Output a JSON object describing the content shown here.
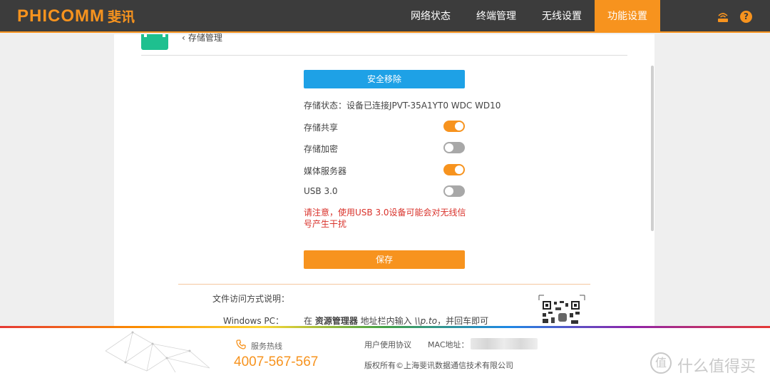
{
  "header": {
    "logo_text": "PHICOMM",
    "logo_cn": "斐讯",
    "nav": [
      {
        "label": "网络状态",
        "active": false
      },
      {
        "label": "终端管理",
        "active": false
      },
      {
        "label": "无线设置",
        "active": false
      },
      {
        "label": "功能设置",
        "active": true
      }
    ],
    "help_glyph": "?"
  },
  "page": {
    "back_label": "存储管理",
    "remove_button": "安全移除",
    "status_text": "存储状态：设备已连接JPVT-35A1YT0 WDC WD10",
    "settings": [
      {
        "label": "存储共享",
        "on": true
      },
      {
        "label": "存储加密",
        "on": false
      },
      {
        "label": "媒体服务器",
        "on": true
      },
      {
        "label": "USB 3.0",
        "on": false
      }
    ],
    "warning": "请注意，使用USB 3.0设备可能会对无线信号产生干扰",
    "save_button": "保存",
    "access_title": "文件访问方式说明：",
    "windows_label": "Windows PC：",
    "windows_instr_pre": "在 ",
    "windows_instr_bold": "资源管理器",
    "windows_instr_mid": " 地址栏内输入 ",
    "windows_instr_path": "\\\\p.to",
    "windows_instr_post": "，并回车即可"
  },
  "footer": {
    "hotline_label": "服务热线",
    "phone": "4007-567-567",
    "agreement": "用户使用协议",
    "mac_label": "MAC地址：",
    "copyright": "版权所有©上海斐讯数据通信技术有限公司",
    "watermark_badge": "值",
    "watermark_text": "什么值得买"
  },
  "colors": {
    "accent": "#f7931e",
    "topbar": "#3c3c3c",
    "button_blue": "#1ea1e6",
    "toggle_off": "#a8a8a8",
    "warning": "#d9322b",
    "tile": "#1ec08f"
  },
  "icons": {
    "router": "router-icon",
    "help": "help-icon",
    "back": "chevron-left-icon",
    "phone": "phone-icon",
    "qr": "qr-code-icon"
  }
}
